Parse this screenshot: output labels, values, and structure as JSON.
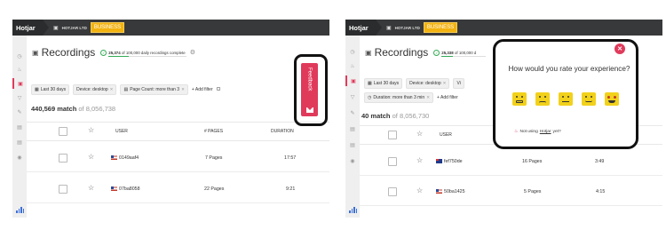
{
  "app": {
    "brand": "Hotjar",
    "site_name": "HOTJAR LTD",
    "plan_badge": "BUSINESS"
  },
  "sidebar": {
    "icons": [
      "dashboard-icon",
      "heatmap-icon",
      "recordings-icon",
      "funnels-icon",
      "forms-icon",
      "polls-icon",
      "surveys-icon",
      "recruiters-icon",
      "incoming-feedback-icon"
    ]
  },
  "left": {
    "page_title": "Recordings",
    "quota_count": "25,374",
    "quota_suffix": "of 100,000 daily recordings complete",
    "quota_fraction": 0.254,
    "filters": [
      {
        "label": "Last 30 days"
      },
      {
        "label": "Device: desktop"
      },
      {
        "label": "Page Count: more than 3"
      }
    ],
    "add_filter": "+ Add filter",
    "clear": "Cl",
    "match_count": "440,569 match",
    "match_total": "of 8,056,738",
    "columns": {
      "user": "USER",
      "pages": "# PAGES",
      "duration": "DURATION"
    },
    "rows": [
      {
        "user": "0149aaf4",
        "pages": "7 Pages",
        "duration": "17:57"
      },
      {
        "user": "07ba8058",
        "pages": "22 Pages",
        "duration": "9:21"
      }
    ],
    "feedback_tab": "Feedback"
  },
  "right": {
    "page_title": "Recordings",
    "quota_count": "25,338",
    "quota_suffix": "of 100,000 d",
    "quota_fraction": 0.253,
    "filters_row1": [
      {
        "label": "Last 30 days"
      },
      {
        "label": "Device: desktop"
      },
      {
        "label": "Vi"
      }
    ],
    "filters_row2": [
      {
        "label": "Duration: more than 3 min"
      }
    ],
    "add_filter": "+ Add filter",
    "match_count": "40 match",
    "match_total": "of 8,056,730",
    "columns": {
      "user": "USER"
    },
    "rows": [
      {
        "user": "fef750de",
        "pages": "16 Pages",
        "duration": "3:49"
      },
      {
        "user": "50ba1425",
        "pages": "5 Pages",
        "duration": "4:15"
      }
    ],
    "popup": {
      "question": "How would you rate your experience?",
      "faces": [
        "hate-face-icon",
        "dislike-face-icon",
        "neutral-face-icon",
        "like-face-icon",
        "love-face-icon"
      ],
      "footer_prefix": "Not using",
      "footer_link": "Hotjar",
      "footer_suffix": "yet?"
    }
  },
  "colors": {
    "topbar": "#38393a",
    "badge": "#f2b20f",
    "accent": "#e03a5b",
    "success": "#33aa55",
    "face": "#f2d11b"
  }
}
